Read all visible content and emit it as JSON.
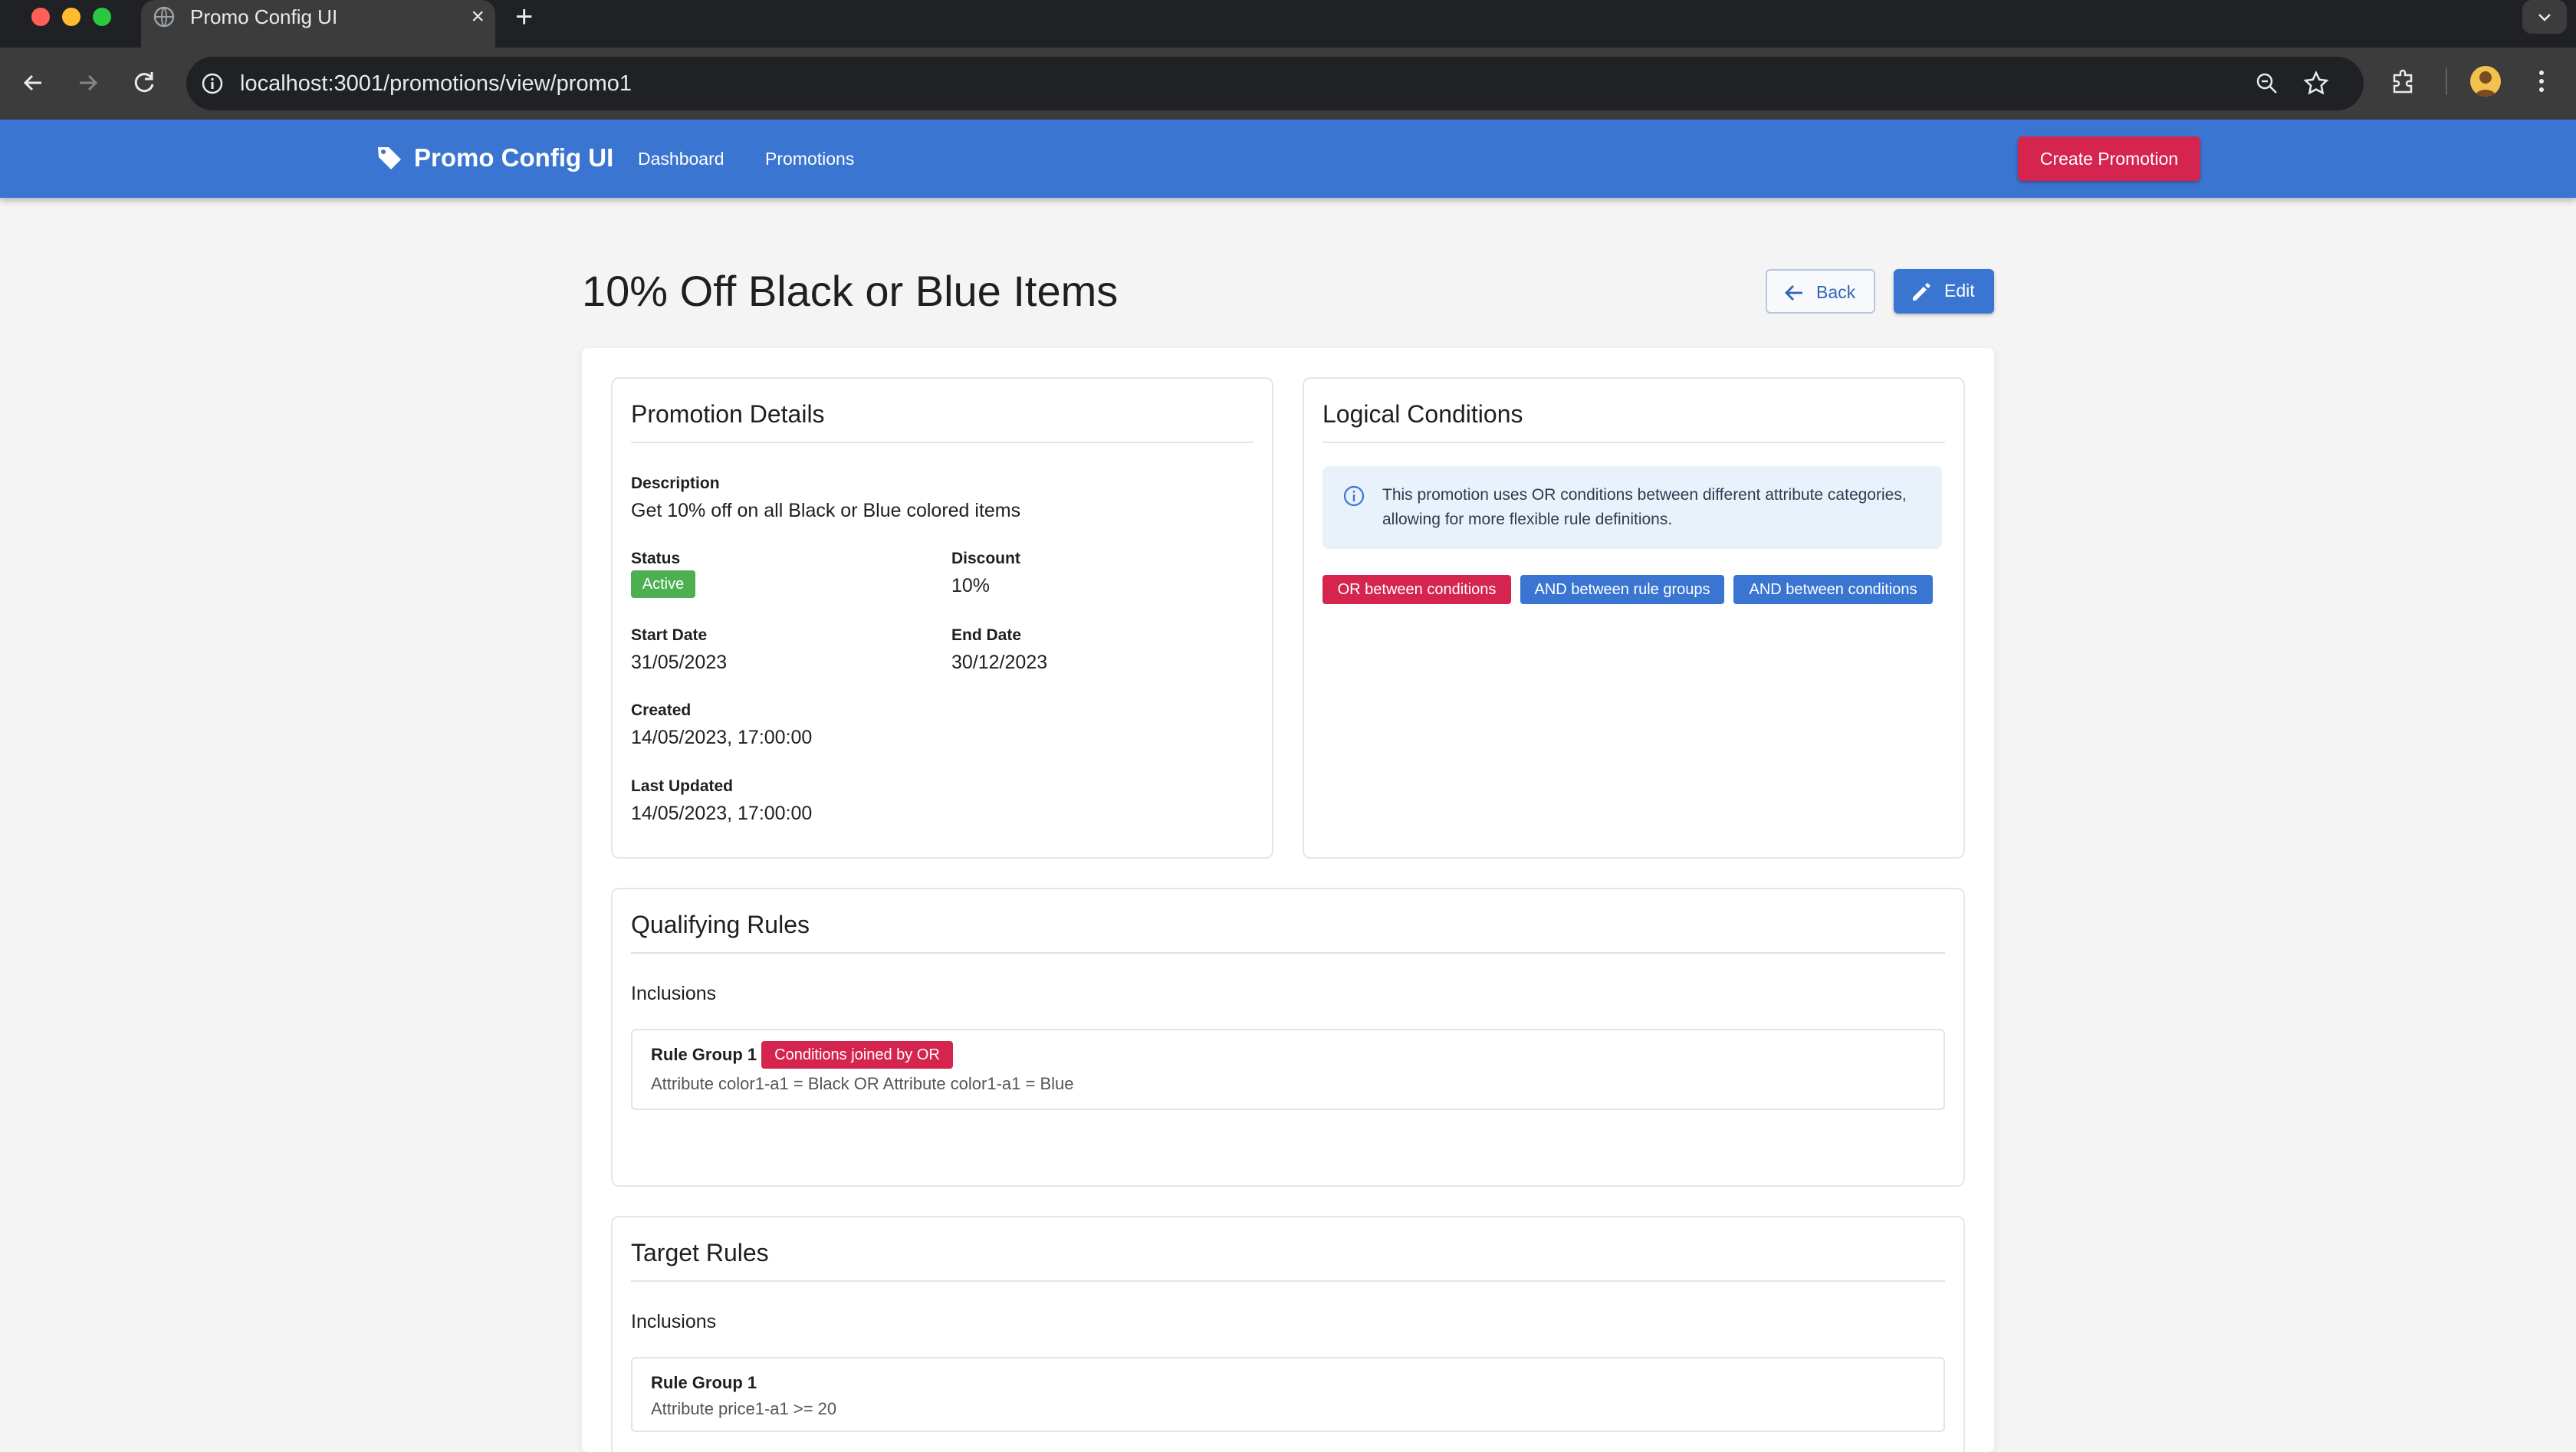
{
  "browser": {
    "tab_title": "Promo Config UI",
    "url": "localhost:3001/promotions/view/promo1",
    "new_tab_label": "+",
    "close_tab_label": "×"
  },
  "app": {
    "brand": "Promo Config UI",
    "nav": [
      {
        "label": "Dashboard"
      },
      {
        "label": "Promotions"
      }
    ],
    "create_button": "Create Promotion"
  },
  "page": {
    "title": "10% Off Black or Blue Items",
    "back_label": "Back",
    "edit_label": "Edit"
  },
  "details": {
    "heading": "Promotion Details",
    "description_label": "Description",
    "description": "Get 10% off on all Black or Blue colored items",
    "status_label": "Status",
    "status": "Active",
    "discount_label": "Discount",
    "discount": "10%",
    "start_label": "Start Date",
    "start": "31/05/2023",
    "end_label": "End Date",
    "end": "30/12/2023",
    "created_label": "Created",
    "created": "14/05/2023, 17:00:00",
    "updated_label": "Last Updated",
    "updated": "14/05/2023, 17:00:00"
  },
  "logic": {
    "heading": "Logical Conditions",
    "info": "This promotion uses OR conditions between different attribute categories, allowing for more flexible rule definitions.",
    "chips": [
      {
        "label": "OR between conditions",
        "color": "#d5254f"
      },
      {
        "label": "AND between rule groups",
        "color": "#3a75d1"
      },
      {
        "label": "AND between conditions",
        "color": "#3a75d1"
      }
    ]
  },
  "qualifying": {
    "heading": "Qualifying Rules",
    "sub": "Inclusions",
    "group_title": "Rule Group 1",
    "group_chip": "Conditions joined by OR",
    "expression": "Attribute color1-a1 = Black OR Attribute color1-a1 = Blue"
  },
  "target": {
    "heading": "Target Rules",
    "sub": "Inclusions",
    "group_title": "Rule Group 1",
    "expression": "Attribute price1-a1 >= 20"
  },
  "colors": {
    "app_bar": "#3a75d1",
    "danger": "#d5254f",
    "success": "#4caf50"
  }
}
